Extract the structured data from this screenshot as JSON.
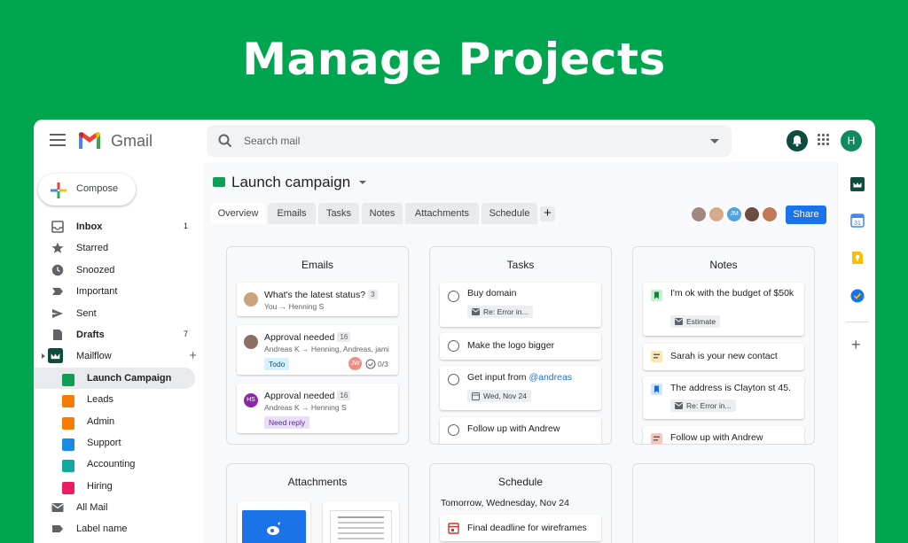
{
  "hero": {
    "title": "Manage Projects"
  },
  "header": {
    "app_name": "Gmail",
    "search_placeholder": "Search mail",
    "avatar_initial": "H"
  },
  "sidebar": {
    "compose_label": "Compose",
    "items": [
      {
        "label": "Inbox",
        "count": "1",
        "bold": true
      },
      {
        "label": "Starred",
        "count": ""
      },
      {
        "label": "Snoozed",
        "count": ""
      },
      {
        "label": "Important",
        "count": ""
      },
      {
        "label": "Sent",
        "count": ""
      },
      {
        "label": "Drafts",
        "count": "7",
        "bold": true
      },
      {
        "label": "Mailflow",
        "count": ""
      },
      {
        "label": "Launch Campaign",
        "folder_color": "#0f9d58",
        "active": true
      },
      {
        "label": "Leads",
        "folder_color": "#f57c00"
      },
      {
        "label": "Admin",
        "folder_color": "#f57c00"
      },
      {
        "label": "Support",
        "folder_color": "#1e88e5"
      },
      {
        "label": "Accounting",
        "folder_color": "#12a89d"
      },
      {
        "label": "Hiring",
        "folder_color": "#e91e63"
      },
      {
        "label": "All Mail",
        "count": ""
      },
      {
        "label": "Label name",
        "count": ""
      }
    ]
  },
  "project": {
    "title": "Launch campaign",
    "tabs": [
      "Overview",
      "Emails",
      "Tasks",
      "Notes",
      "Attachments",
      "Schedule"
    ],
    "tab_add": "+",
    "share_label": "Share",
    "people": [
      "",
      "",
      "JM",
      "",
      ""
    ]
  },
  "emails_card": {
    "title": "Emails",
    "items": [
      {
        "subject": "What's the latest status?",
        "count": "3",
        "meta": "You → Henning S",
        "avatar_color": "#c9a27e"
      },
      {
        "subject": "Approval needed",
        "count": "16",
        "meta": "Andreas K → Henning, Andreas, jami",
        "chip": "Todo",
        "assignee": "JW",
        "progress": "0/3",
        "avatar_color": "#8d6e63"
      },
      {
        "subject": "Approval needed",
        "count": "16",
        "meta": "Andreas K → Henning S",
        "chip": "Need reply",
        "avatar_initials": "HS",
        "avatar_color": "#8e24aa"
      }
    ]
  },
  "tasks_card": {
    "title": "Tasks",
    "items": [
      {
        "text": "Buy domain",
        "chip": "Re: Error in..."
      },
      {
        "text": "Make the logo bigger"
      },
      {
        "text_prefix": "Get input from ",
        "mention": "@andreas",
        "chip": "Wed, Nov 24"
      },
      {
        "text": "Follow up with Andrew"
      }
    ]
  },
  "notes_card": {
    "title": "Notes",
    "items": [
      {
        "text": "I'm ok with the budget of $50k",
        "chip": "Estimate"
      },
      {
        "text": "Sarah is your new contact"
      },
      {
        "text": "The address is Clayton st 45.",
        "chip": "Re: Error in..."
      },
      {
        "text": "Follow up with Andrew"
      }
    ]
  },
  "attachments_card": {
    "title": "Attachments"
  },
  "schedule_card": {
    "title": "Schedule",
    "date": "Tomorrow, Wednesday, Nov 24",
    "items": [
      {
        "text": "Final deadline for wireframes"
      }
    ]
  },
  "colors": {
    "background": "#00a54f",
    "accent": "#1a73e8",
    "todo_chip": "#d6f1fb",
    "need_reply_chip": "#e9ddf8"
  }
}
